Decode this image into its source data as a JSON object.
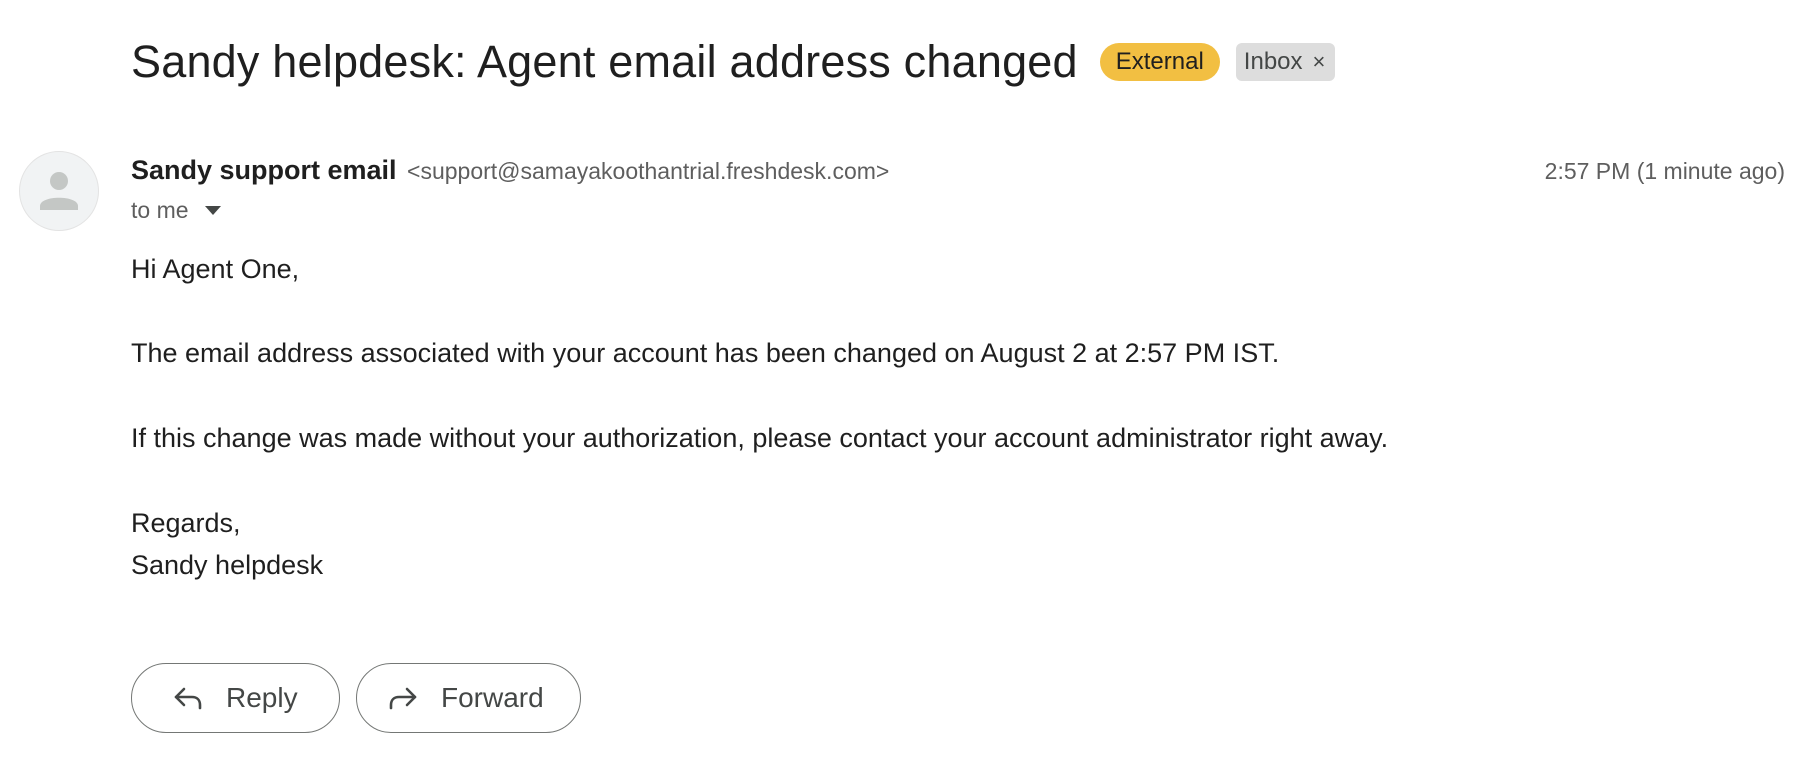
{
  "email": {
    "subject": "Sandy helpdesk: Agent email address changed",
    "labels": {
      "external": "External",
      "inbox": "Inbox",
      "remove_glyph": "×"
    },
    "sender": {
      "name": "Sandy support email",
      "address": "<support@samayakoothantrial.freshdesk.com>",
      "avatar_icon": "person-icon"
    },
    "timestamp": "2:57 PM (1 minute ago)",
    "recipient": "to me",
    "body": {
      "greeting": "Hi Agent One,",
      "paragraph1": "The email address associated with your account has been changed on August 2 at 2:57 PM IST.",
      "paragraph2": "If this change was made without your authorization, please contact your account administrator right away.",
      "closing": "Regards,",
      "signature": "Sandy helpdesk"
    }
  },
  "actions": {
    "reply_label": "Reply",
    "reply_icon": "reply-arrow-icon",
    "forward_label": "Forward",
    "forward_icon": "forward-arrow-icon"
  },
  "colors": {
    "external_label_bg": "#f2bf42",
    "inbox_label_bg": "#dddddd",
    "text_primary": "#1f1f1f",
    "text_secondary": "#5e5e5e"
  }
}
